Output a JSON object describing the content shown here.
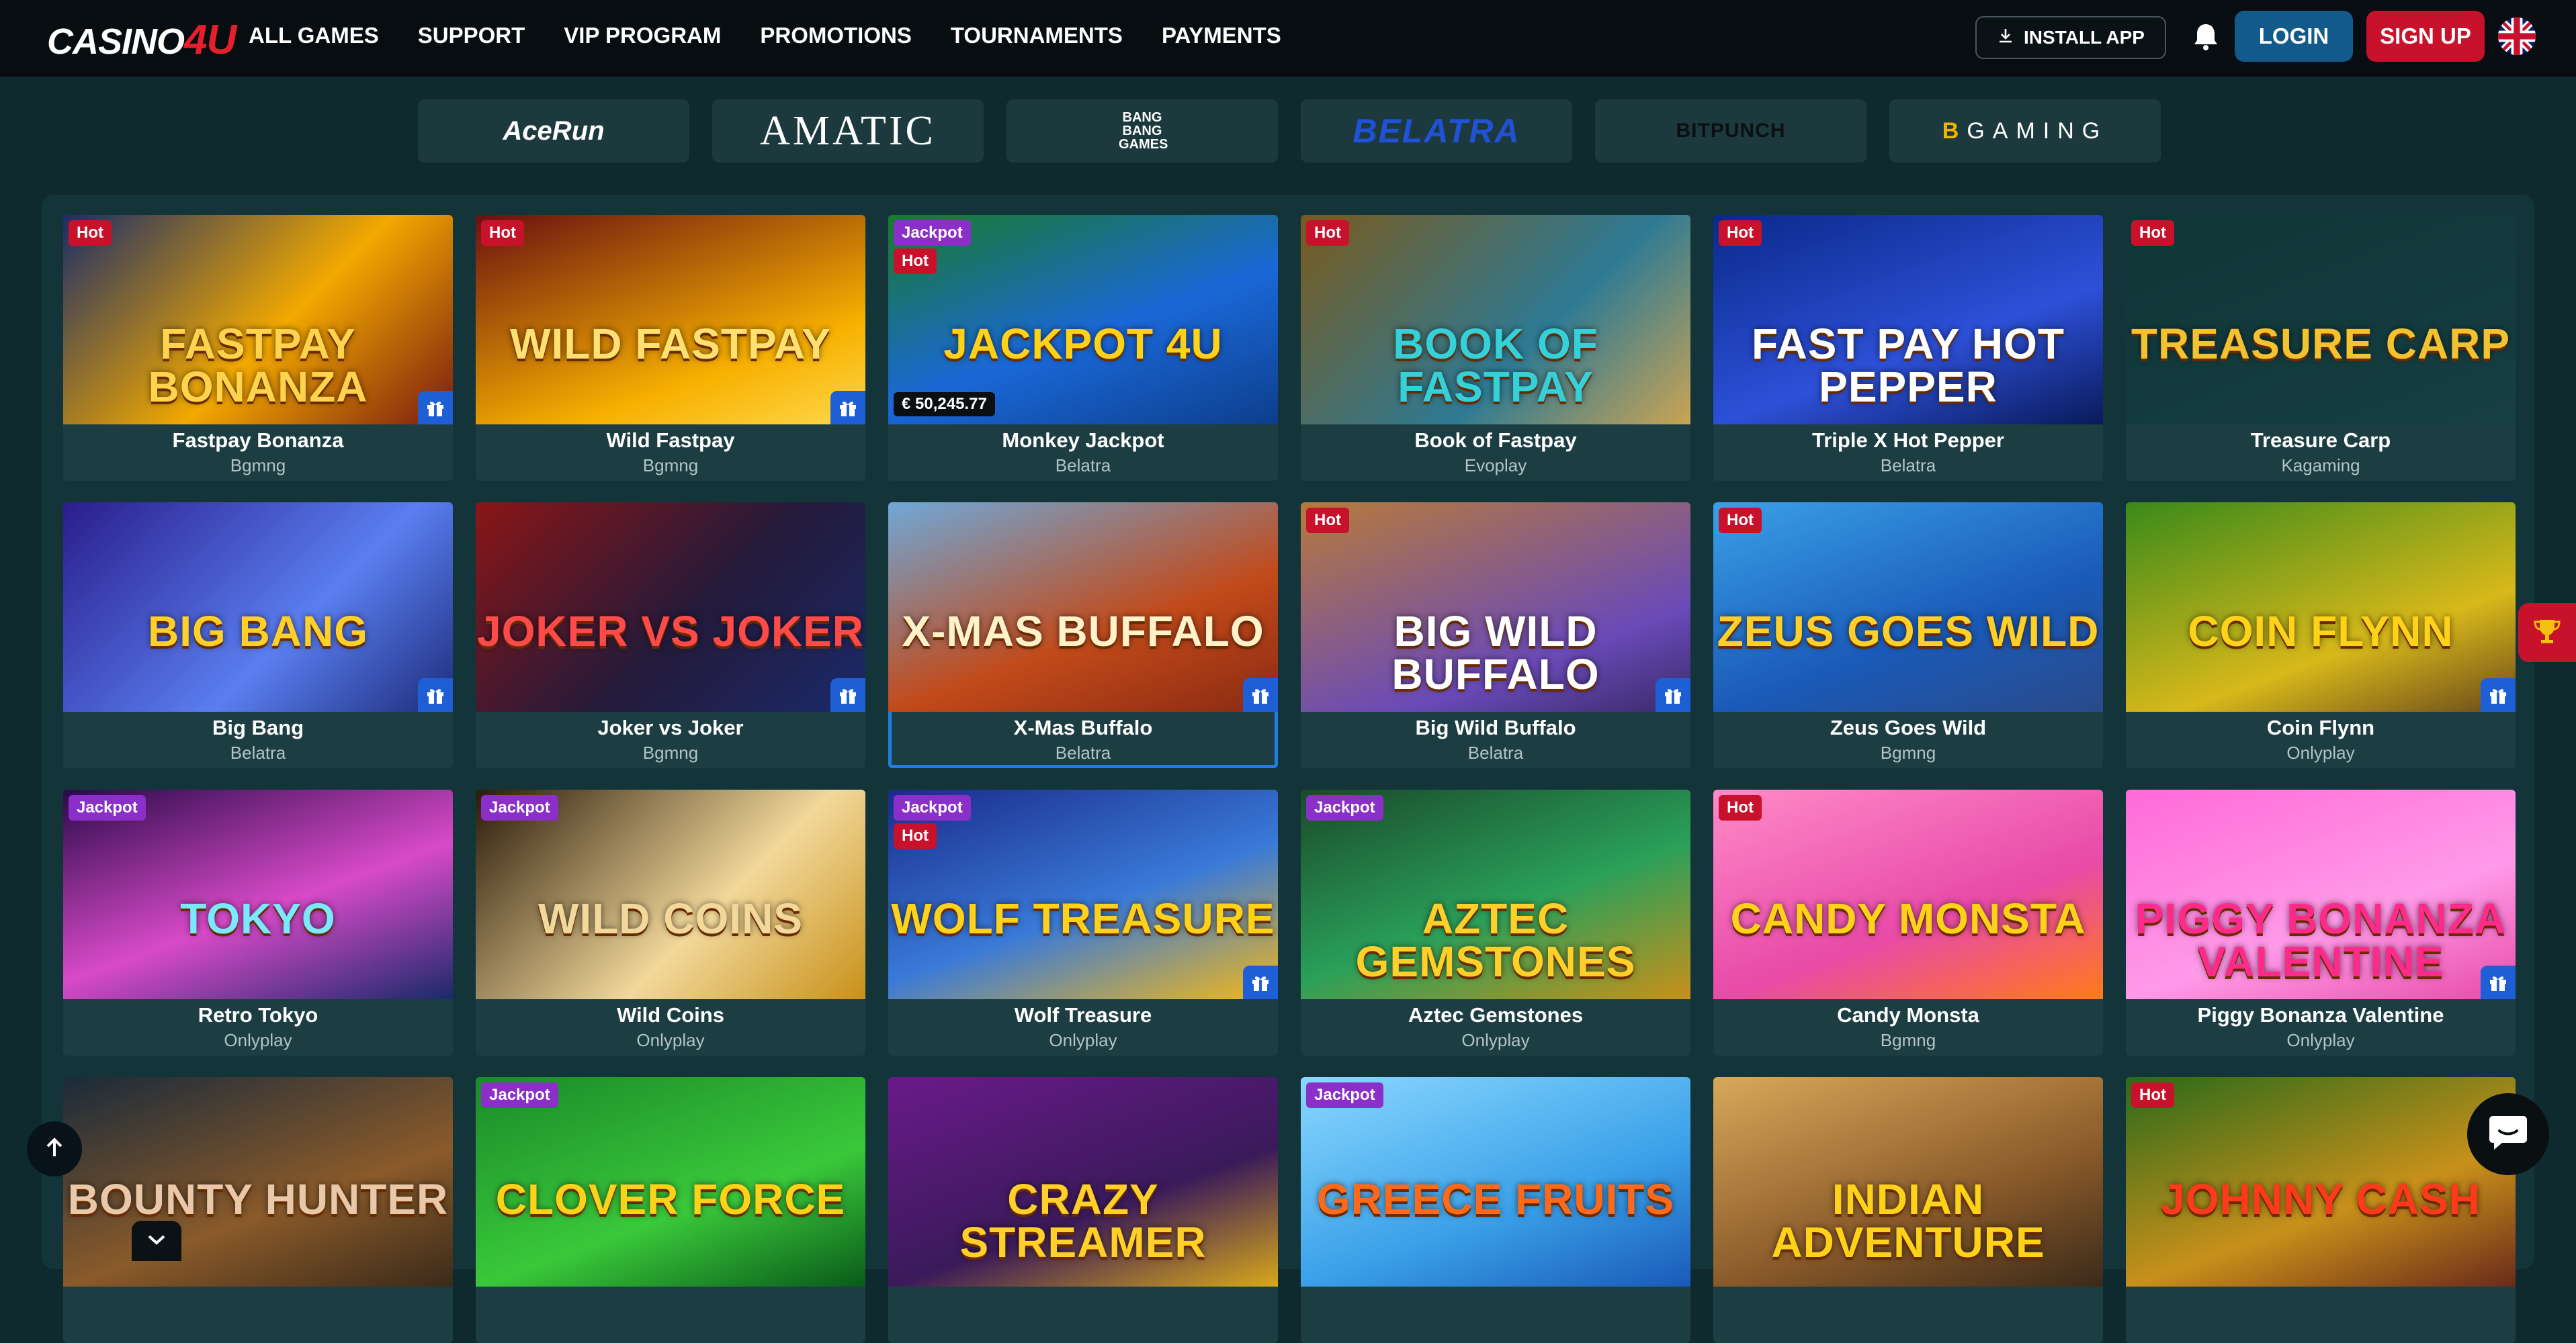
{
  "brand": {
    "logo_main": "CASINO",
    "logo_accent": "4U"
  },
  "nav": {
    "items": [
      "ALL GAMES",
      "SUPPORT",
      "VIP PROGRAM",
      "PROMOTIONS",
      "TOURNAMENTS",
      "PAYMENTS"
    ]
  },
  "header": {
    "install_label": "INSTALL APP",
    "login_label": "LOGIN",
    "signup_label": "SIGN UP"
  },
  "providers": [
    "AceRun",
    "AMATIC",
    "BANG BANG GAMES",
    "BELATRA",
    "BITPUNCH",
    "GAMING"
  ],
  "colors": {
    "hot": "#c8122b",
    "jackpot": "#8a2fc7",
    "gift": "#1e5fd6",
    "login": "#135a8c",
    "signup": "#c8122b",
    "bg": "#0f2a2e"
  },
  "games": [
    {
      "name": "Fastpay Bonanza",
      "provider": "Bgmng",
      "badges": [
        "Hot"
      ],
      "gift": true,
      "art": "FASTPAY BONANZA"
    },
    {
      "name": "Wild Fastpay",
      "provider": "Bgmng",
      "badges": [
        "Hot"
      ],
      "gift": true,
      "art": "WILD FASTPAY"
    },
    {
      "name": "Monkey Jackpot",
      "provider": "Belatra",
      "badges": [
        "Jackpot",
        "Hot"
      ],
      "gift": false,
      "art": "JACKPOT 4U",
      "jackpot_amount": "€ 50,245.77"
    },
    {
      "name": "Book of Fastpay",
      "provider": "Evoplay",
      "badges": [
        "Hot"
      ],
      "gift": false,
      "art": "BOOK OF FASTPAY"
    },
    {
      "name": "Triple X Hot Pepper",
      "provider": "Belatra",
      "badges": [
        "Hot"
      ],
      "gift": false,
      "art": "FAST PAY HOT PEPPER"
    },
    {
      "name": "Treasure Carp",
      "provider": "Kagaming",
      "badges": [
        "Hot"
      ],
      "gift": false,
      "art": "TREASURE CARP"
    },
    {
      "name": "Big Bang",
      "provider": "Belatra",
      "badges": [],
      "gift": true,
      "art": "BIG BANG"
    },
    {
      "name": "Joker vs Joker",
      "provider": "Bgmng",
      "badges": [],
      "gift": true,
      "art": "JOKER VS JOKER"
    },
    {
      "name": "X-Mas Buffalo",
      "provider": "Belatra",
      "badges": [],
      "gift": true,
      "art": "X-MAS BUFFALO",
      "selected": true
    },
    {
      "name": "Big Wild Buffalo",
      "provider": "Belatra",
      "badges": [
        "Hot"
      ],
      "gift": true,
      "art": "BIG WILD BUFFALO"
    },
    {
      "name": "Zeus Goes Wild",
      "provider": "Bgmng",
      "badges": [
        "Hot"
      ],
      "gift": false,
      "art": "ZEUS GOES WILD"
    },
    {
      "name": "Coin Flynn",
      "provider": "Onlyplay",
      "badges": [],
      "gift": true,
      "art": "COIN FLYNN"
    },
    {
      "name": "Retro Tokyo",
      "provider": "Onlyplay",
      "badges": [
        "Jackpot"
      ],
      "gift": false,
      "art": "TOKYO"
    },
    {
      "name": "Wild Coins",
      "provider": "Onlyplay",
      "badges": [
        "Jackpot"
      ],
      "gift": false,
      "art": "WILD COINS"
    },
    {
      "name": "Wolf Treasure",
      "provider": "Onlyplay",
      "badges": [
        "Jackpot",
        "Hot"
      ],
      "gift": true,
      "art": "WOLF TREASURE"
    },
    {
      "name": "Aztec Gemstones",
      "provider": "Onlyplay",
      "badges": [
        "Jackpot"
      ],
      "gift": false,
      "art": "AZTEC GEMSTONES"
    },
    {
      "name": "Candy Monsta",
      "provider": "Bgmng",
      "badges": [
        "Hot"
      ],
      "gift": false,
      "art": "CANDY MONSTA"
    },
    {
      "name": "Piggy Bonanza Valentine",
      "provider": "Onlyplay",
      "badges": [],
      "gift": true,
      "art": "PIGGY BONANZA VALENTINE"
    },
    {
      "name": "",
      "provider": "",
      "badges": [],
      "gift": false,
      "art": "BOUNTY HUNTER"
    },
    {
      "name": "",
      "provider": "",
      "badges": [
        "Jackpot"
      ],
      "gift": false,
      "art": "CLOVER FORCE"
    },
    {
      "name": "",
      "provider": "",
      "badges": [],
      "gift": false,
      "art": "CRAZY STREAMER"
    },
    {
      "name": "",
      "provider": "",
      "badges": [
        "Jackpot"
      ],
      "gift": false,
      "art": "GREECE FRUITS"
    },
    {
      "name": "",
      "provider": "",
      "badges": [],
      "gift": false,
      "art": "INDIAN ADVENTURE"
    },
    {
      "name": "",
      "provider": "",
      "badges": [
        "Hot"
      ],
      "gift": false,
      "art": "JOHNNY CASH"
    }
  ]
}
